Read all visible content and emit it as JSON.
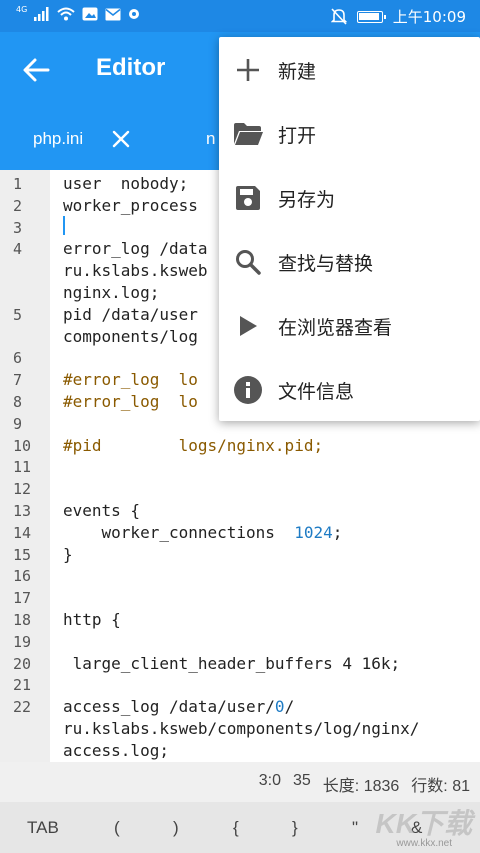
{
  "status_bar": {
    "network": "4G",
    "time": "上午10:09"
  },
  "app_bar": {
    "title": "Editor"
  },
  "tabs": [
    {
      "label": "php.ini"
    },
    {
      "label": "n"
    }
  ],
  "editor": {
    "lines": [
      {
        "num": "1",
        "text": "user  nobody;"
      },
      {
        "num": "2",
        "text": "worker_process"
      },
      {
        "num": "3",
        "text": ""
      },
      {
        "num": "4",
        "text": "error_log /data"
      },
      {
        "num": "",
        "text": "ru.kslabs.ksweb"
      },
      {
        "num": "",
        "text": "nginx.log;"
      },
      {
        "num": "5",
        "text": "pid /data/user"
      },
      {
        "num": "",
        "text": "components/log"
      },
      {
        "num": "6",
        "text": ""
      },
      {
        "num": "7",
        "text": "#error_log  lo",
        "type": "comment"
      },
      {
        "num": "8",
        "text": "#error_log  lo",
        "type": "comment"
      },
      {
        "num": "9",
        "text": ""
      },
      {
        "num": "10",
        "text": "#pid        logs/nginx.pid;",
        "type": "comment"
      },
      {
        "num": "11",
        "text": ""
      },
      {
        "num": "12",
        "text": ""
      },
      {
        "num": "13",
        "text": "events {"
      },
      {
        "num": "14",
        "text": "    worker_connections  ",
        "number": "1024",
        "after": ";"
      },
      {
        "num": "15",
        "text": "}"
      },
      {
        "num": "16",
        "text": ""
      },
      {
        "num": "17",
        "text": ""
      },
      {
        "num": "18",
        "text": "http {"
      },
      {
        "num": "19",
        "text": ""
      },
      {
        "num": "20",
        "text": " large_client_header_buffers 4 16k;"
      },
      {
        "num": "21",
        "text": ""
      },
      {
        "num": "22",
        "text": "access_log /data/user/",
        "number": "0",
        "after": "/"
      },
      {
        "num": "",
        "text": "ru.kslabs.ksweb/components/log/nginx/"
      },
      {
        "num": "",
        "text": "access.log;"
      }
    ]
  },
  "info_bar": {
    "position": "3:0",
    "column": "35",
    "length": "长度: 1836",
    "line_count": "行数: 81"
  },
  "symbol_bar": {
    "keys": [
      "TAB",
      "(",
      ")",
      "{",
      "}",
      "\"",
      "&"
    ]
  },
  "watermark": {
    "logo": "KK下载",
    "site": "www.kkx.net"
  },
  "menu": {
    "items": [
      {
        "label": "新建",
        "icon": "plus-icon"
      },
      {
        "label": "打开",
        "icon": "folder-open-icon"
      },
      {
        "label": "另存为",
        "icon": "save-icon"
      },
      {
        "label": "查找与替换",
        "icon": "search-icon"
      },
      {
        "label": "在浏览器查看",
        "icon": "play-icon"
      },
      {
        "label": "文件信息",
        "icon": "info-icon"
      }
    ]
  },
  "colors": {
    "primary": "#2196f3",
    "status_bar": "#1e88e5",
    "comment": "#8a5a00",
    "number": "#1e7bc4"
  }
}
